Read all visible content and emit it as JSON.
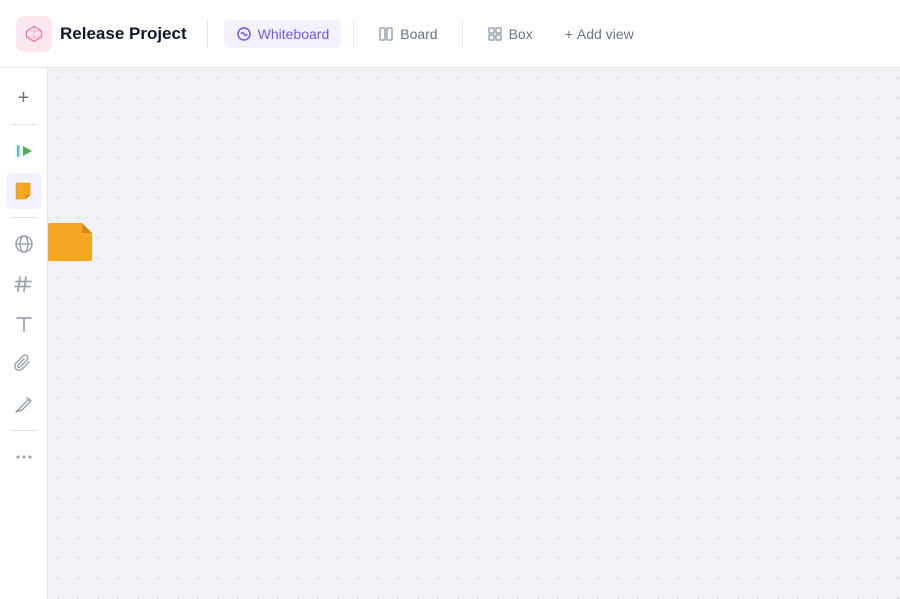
{
  "header": {
    "project_title": "Release Project",
    "tabs": [
      {
        "id": "whiteboard",
        "label": "Whiteboard",
        "active": true
      },
      {
        "id": "board",
        "label": "Board",
        "active": false
      },
      {
        "id": "box",
        "label": "Box",
        "active": false
      }
    ],
    "add_view_label": "Add view"
  },
  "sidebar": {
    "items": [
      {
        "id": "add",
        "icon": "+",
        "label": "Add",
        "active": false
      },
      {
        "id": "shapes",
        "icon": "shapes",
        "label": "Shapes",
        "active": false
      },
      {
        "id": "sticky",
        "icon": "sticky",
        "label": "Sticky Note",
        "active": true
      },
      {
        "id": "globe",
        "icon": "🌐",
        "label": "Globe",
        "active": false
      },
      {
        "id": "hashtag",
        "icon": "#",
        "label": "Hashtag",
        "active": false
      },
      {
        "id": "text",
        "icon": "T",
        "label": "Text",
        "active": false
      },
      {
        "id": "attach",
        "icon": "attach",
        "label": "Attach",
        "active": false
      },
      {
        "id": "pen",
        "icon": "pen",
        "label": "Pen",
        "active": false
      },
      {
        "id": "more",
        "icon": "...",
        "label": "More",
        "active": false
      }
    ]
  },
  "canvas": {
    "background_color": "#f0f2f5"
  }
}
